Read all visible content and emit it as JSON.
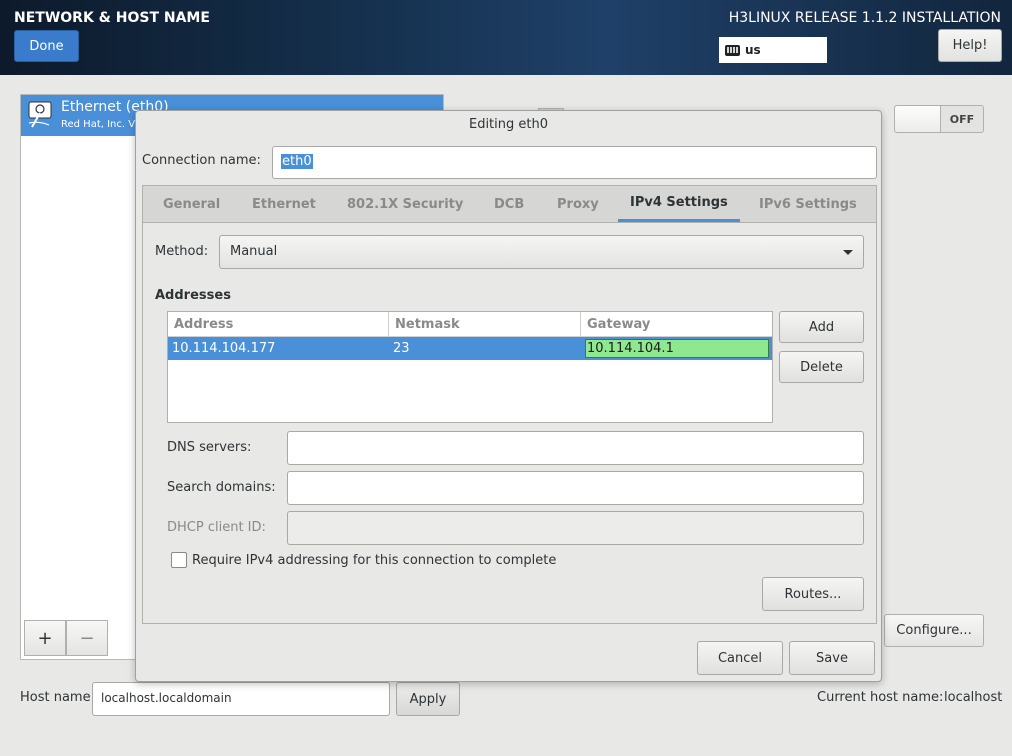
{
  "header": {
    "title": "NETWORK & HOST NAME",
    "release": "H3LINUX RELEASE 1.1.2 INSTALLATION",
    "done_label": "Done",
    "keyboard_layout": "us",
    "help_label": "Help!"
  },
  "device_list": {
    "items": [
      {
        "name": "Ethernet (eth0)",
        "vendor": "Red Hat, Inc. Vi"
      }
    ],
    "add_label": "+",
    "remove_label": "−"
  },
  "device_panel": {
    "toggle_state": "OFF",
    "configure_label": "Configure..."
  },
  "hostname": {
    "label": "Host name:",
    "value": "localhost.localdomain",
    "apply_label": "Apply",
    "current_label": "Current host name:",
    "current_value": "localhost"
  },
  "dialog": {
    "title": "Editing eth0",
    "connection_name_label": "Connection name:",
    "connection_name_value": "eth0",
    "tabs": [
      {
        "label": "General"
      },
      {
        "label": "Ethernet"
      },
      {
        "label": "802.1X Security"
      },
      {
        "label": "DCB"
      },
      {
        "label": "Proxy"
      },
      {
        "label": "IPv4 Settings"
      },
      {
        "label": "IPv6 Settings"
      }
    ],
    "active_tab": "IPv4 Settings",
    "ipv4": {
      "method_label": "Method:",
      "method_value": "Manual",
      "addresses_heading": "Addresses",
      "columns": [
        "Address",
        "Netmask",
        "Gateway"
      ],
      "rows": [
        {
          "address": "10.114.104.177",
          "netmask": "23",
          "gateway": "10.114.104.1"
        }
      ],
      "add_label": "Add",
      "delete_label": "Delete",
      "dns_label": "DNS servers:",
      "dns_value": "",
      "search_label": "Search domains:",
      "search_value": "",
      "dhcp_label": "DHCP client ID:",
      "dhcp_value": "",
      "require_label": "Require IPv4 addressing for this connection to complete",
      "routes_label": "Routes..."
    },
    "cancel_label": "Cancel",
    "save_label": "Save"
  },
  "colors": {
    "accent": "#4a90d9",
    "highlight_cell": "#8fe88f",
    "header_bg": "#15304d"
  }
}
